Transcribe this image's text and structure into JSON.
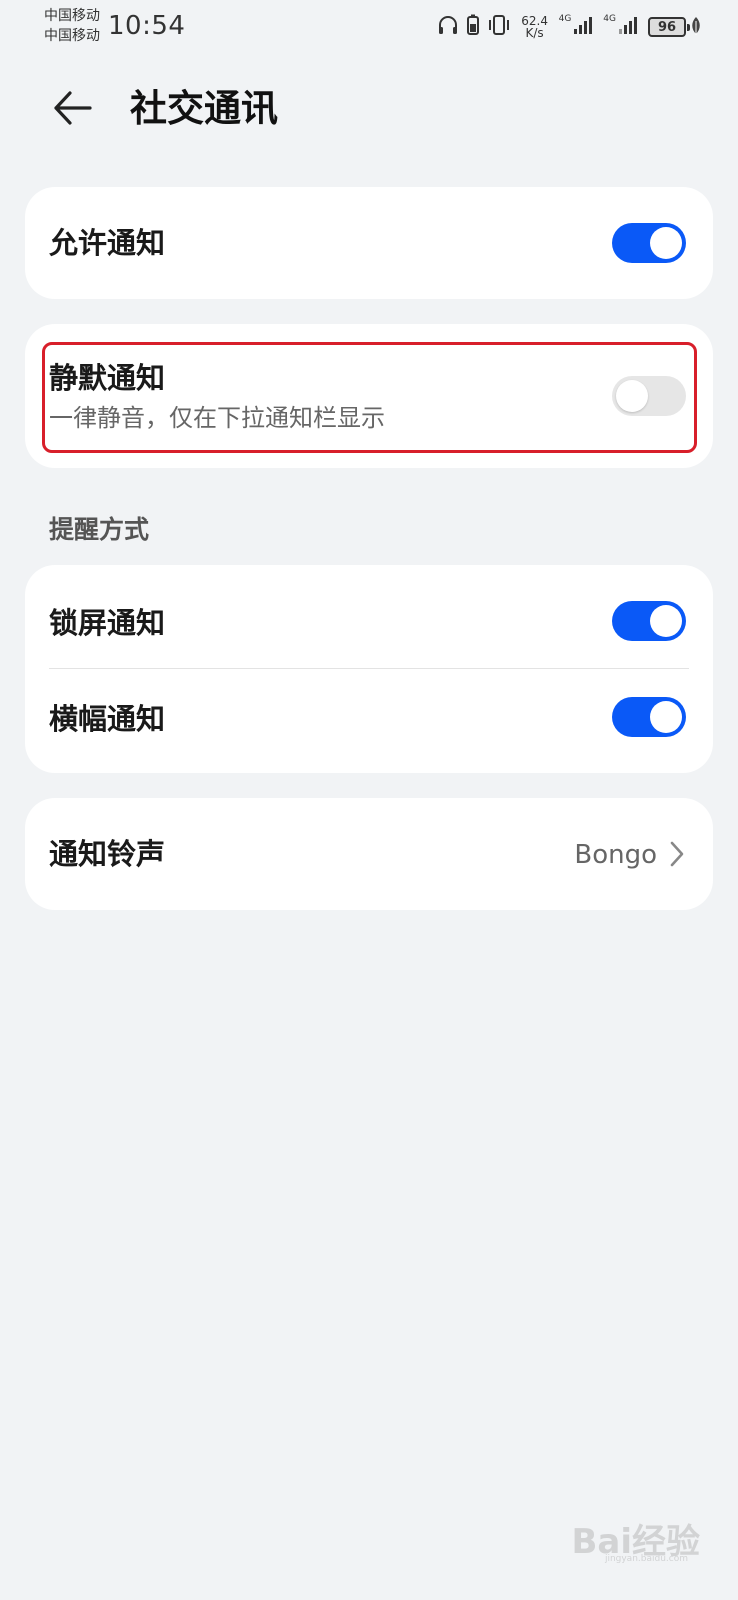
{
  "status_bar": {
    "carrier_1": "中国移动",
    "carrier_2": "中国移动",
    "time": "10:54",
    "net_speed_value": "62.4",
    "net_speed_unit": "K/s",
    "signal_1_tag": "4G",
    "signal_2_tag": "4G",
    "battery_level": "96",
    "icons": [
      "headphones-icon",
      "battery-saver-icon",
      "vibrate-icon",
      "signal-icon",
      "signal-icon",
      "battery-icon",
      "leaf-icon"
    ]
  },
  "header": {
    "back_icon": "back-arrow-icon",
    "title": "社交通讯"
  },
  "allow_notifications": {
    "label": "允许通知",
    "enabled": true
  },
  "silent_notifications": {
    "label": "静默通知",
    "description": "一律静音，仅在下拉通知栏显示",
    "enabled": false,
    "highlight_color": "#d81f2a"
  },
  "reminder_section": {
    "title": "提醒方式",
    "items": [
      {
        "label": "锁屏通知",
        "enabled": true
      },
      {
        "label": "横幅通知",
        "enabled": true
      }
    ]
  },
  "ringtone": {
    "label": "通知铃声",
    "value": "Bongo",
    "chevron_icon": "chevron-right-icon"
  },
  "colors": {
    "background": "#f1f3f5",
    "card": "#ffffff",
    "accent": "#0a59f7",
    "toggle_off": "#e6e6e6"
  },
  "watermark": {
    "text": "Bai经验",
    "url_text": "jingyan.baidu.com"
  }
}
